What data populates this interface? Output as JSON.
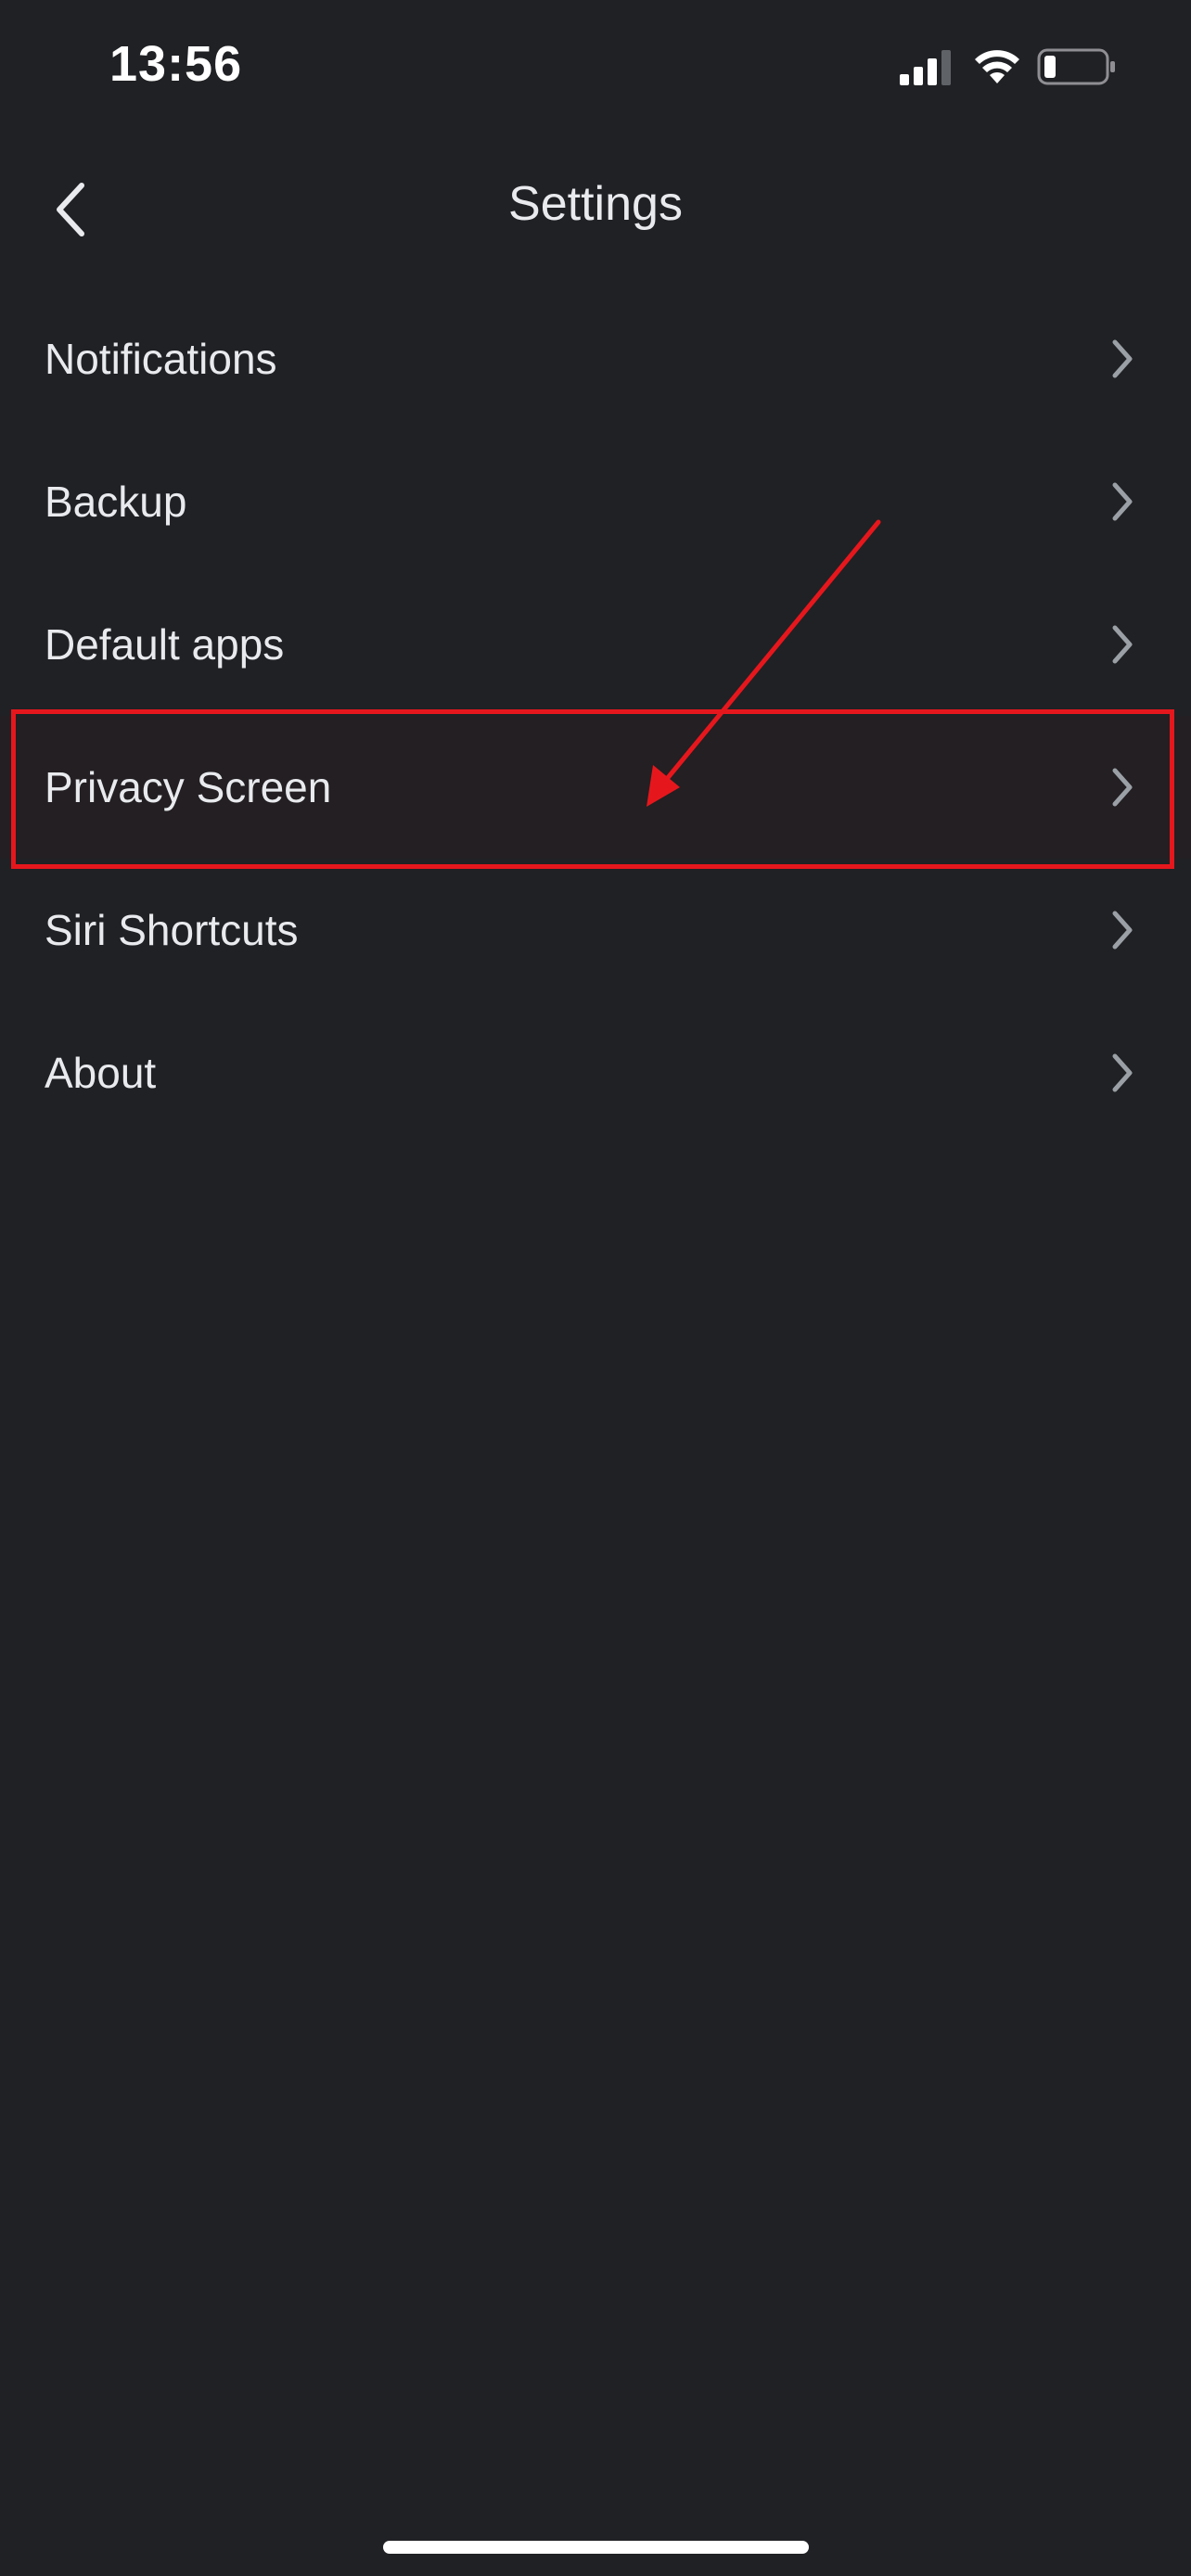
{
  "status_bar": {
    "time": "13:56",
    "icons": [
      "signal-icon",
      "wifi-icon",
      "battery-icon"
    ]
  },
  "header": {
    "title": "Settings",
    "back_icon": "chevron-left-icon"
  },
  "settings": {
    "items": [
      {
        "label": "Notifications"
      },
      {
        "label": "Backup"
      },
      {
        "label": "Default apps"
      },
      {
        "label": "Privacy Screen"
      },
      {
        "label": "Siri Shortcuts"
      },
      {
        "label": "About"
      }
    ]
  },
  "colors": {
    "background": "#202124",
    "text": "#e8eaed",
    "chevron": "#9aa0a6",
    "annotation": "#e5171d"
  }
}
